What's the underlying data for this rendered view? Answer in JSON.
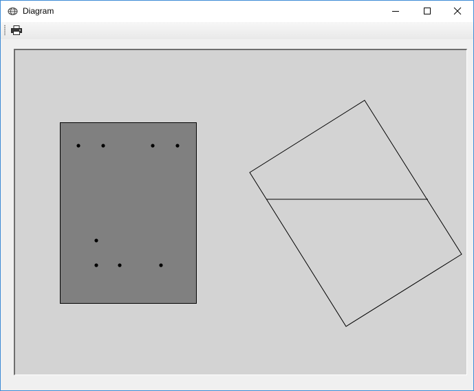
{
  "window": {
    "title": "Diagram",
    "app_icon": "globe-icon",
    "controls": [
      "minimize-icon",
      "maximize-icon",
      "close-icon"
    ]
  },
  "toolbar": {
    "items": [
      {
        "name": "print-button",
        "icon": "printer-icon"
      }
    ]
  },
  "diagram": {
    "background_color": "#d3d3d3",
    "shapes": [
      {
        "kind": "filled-rectangle",
        "fill": "#808080",
        "stroke": "#000000",
        "marker_count": 8
      },
      {
        "kind": "rotated-rectangle-with-diagonal-split",
        "fill": "none",
        "stroke": "#000000"
      }
    ]
  }
}
